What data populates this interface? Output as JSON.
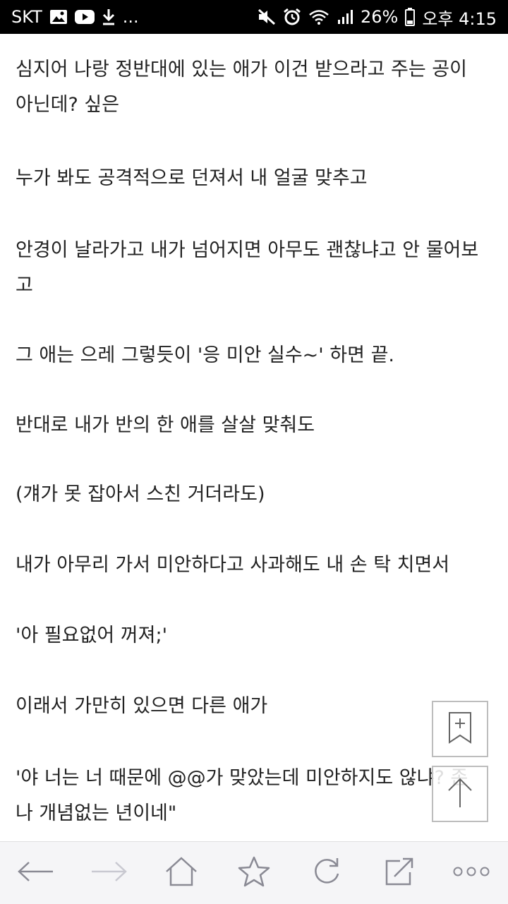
{
  "status_bar": {
    "carrier": "SKT",
    "more": "...",
    "battery": "26%",
    "time": "오후 4:15"
  },
  "article": {
    "paragraphs": [
      "심지어 나랑 정반대에 있는 애가 이건 받으라고 주는 공이\n아닌데? 싶은",
      "누가 봐도 공격적으로 던져서 내 얼굴 맞추고",
      "안경이 날라가고 내가 넘어지면 아무도 괜찮냐고 안 물어보\n고",
      "그 애는 으레 그렇듯이 '응 미안 실수~' 하면 끝.",
      "반대로 내가 반의 한 애를 살살 맞춰도",
      "(걔가 못 잡아서 스친 거더라도)",
      "내가 아무리 가서 미안하다고 사과해도 내 손 탁 치면서",
      "'아 필요없어 꺼져;'",
      "이래서 가만히 있으면 다른 애가",
      "'야 너는 너 때문에 @@가 맞았는데 미안하지도 않냐? 존\n나 개념없는 년이네\""
    ]
  },
  "floating": {
    "bookmark_icon": "bookmark-add-icon",
    "scroll_top_icon": "arrow-up-icon"
  },
  "bottom_nav": {
    "icons": [
      "back-arrow-icon",
      "forward-arrow-icon",
      "home-icon",
      "star-icon",
      "refresh-icon",
      "share-icon",
      "more-icon"
    ],
    "icon_color": "#8a8a94",
    "disabled_color": "#c9c9d1"
  }
}
